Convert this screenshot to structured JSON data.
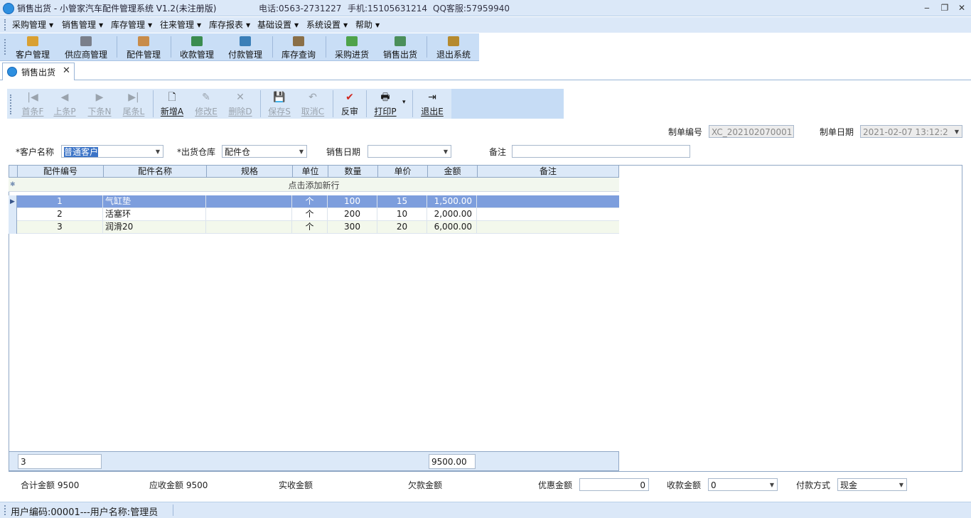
{
  "window": {
    "title": "销售出货 - 小管家汽车配件管理系统 V1.2(未注册版)",
    "phone": "电话:0563-2731227",
    "mobile": "手机:15105631214",
    "qq": "QQ客服:57959940",
    "minimize": "‒",
    "restore": "❐",
    "close": "✕"
  },
  "menu": [
    "采购管理",
    "销售管理",
    "库存管理",
    "往来管理",
    "库存报表",
    "基础设置",
    "系统设置",
    "帮助"
  ],
  "main_toolbar": [
    {
      "label": "客户管理",
      "icon": "customer-icon",
      "color": "#d9a032"
    },
    {
      "label": "供应商管理",
      "icon": "supplier-icon",
      "color": "#7a7f8a"
    },
    {
      "label": "配件管理",
      "icon": "parts-icon",
      "color": "#c88c4a"
    },
    {
      "label": "收款管理",
      "icon": "receipt-icon",
      "color": "#3b8c4f"
    },
    {
      "label": "付款管理",
      "icon": "payment-icon",
      "color": "#3b7fb8"
    },
    {
      "label": "库存查询",
      "icon": "inventory-search-icon",
      "color": "#8a6f47"
    },
    {
      "label": "采购进货",
      "icon": "purchase-icon",
      "color": "#4ea34a"
    },
    {
      "label": "销售出货",
      "icon": "sales-icon",
      "color": "#4b8f5a"
    },
    {
      "label": "退出系统",
      "icon": "exit-system-icon",
      "color": "#b58a2f"
    }
  ],
  "tab": {
    "label": "销售出货",
    "close": "✕"
  },
  "actions": {
    "first": "首条F",
    "prev": "上条P",
    "next": "下条N",
    "last": "尾条L",
    "add": "新增A",
    "edit": "修改E",
    "delete": "删除D",
    "save": "保存S",
    "cancel": "取消C",
    "unaudit": "反审",
    "print": "打印P",
    "exit": "退出E",
    "glyphs": {
      "first": "|◀",
      "prev": "◀",
      "next": "▶",
      "last": "▶|",
      "add": "🗋",
      "edit": "✎",
      "delete": "✕",
      "save": "💾",
      "cancel": "↶",
      "unaudit": "✔",
      "print": "🖶",
      "exit": "⇥",
      "print_dropdown": "▾"
    }
  },
  "form": {
    "doc_no_label": "制单编号",
    "doc_no": "XC_202102070001",
    "doc_date_label": "制单日期",
    "doc_date": "2021-02-07 13:12:2",
    "customer_label": "*客户名称",
    "customer": "普通客户",
    "warehouse_label": "*出货仓库",
    "warehouse": "配件仓",
    "sale_date_label": "销售日期",
    "sale_date": "",
    "remark_label": "备注",
    "remark": ""
  },
  "grid": {
    "columns": [
      "配件编号",
      "配件名称",
      "规格",
      "单位",
      "数量",
      "单价",
      "金额",
      "备注"
    ],
    "new_row_hint": "点击添加新行",
    "rows": [
      {
        "no": "1",
        "name": "气缸垫",
        "spec": "",
        "unit": "个",
        "qty": "100",
        "price": "15",
        "amount": "1,500.00",
        "remark": ""
      },
      {
        "no": "2",
        "name": "活塞环",
        "spec": "",
        "unit": "个",
        "qty": "200",
        "price": "10",
        "amount": "2,000.00",
        "remark": ""
      },
      {
        "no": "3",
        "name": "润滑20",
        "spec": "",
        "unit": "个",
        "qty": "300",
        "price": "20",
        "amount": "6,000.00",
        "remark": ""
      }
    ],
    "footer_count": "3",
    "footer_amount": "9500.00"
  },
  "summary": {
    "total_label": "合计金额",
    "total": "9500",
    "receivable_label": "应收金额",
    "receivable": "9500",
    "received_label": "实收金额",
    "received": "",
    "owed_label": "欠款金额",
    "owed": "",
    "discount_label": "优惠金额",
    "discount": "0",
    "collect_label": "收款金额",
    "collect": "0",
    "paymethod_label": "付款方式",
    "paymethod": "现金"
  },
  "status": {
    "text": "用户编码:00001---用户名称:管理员"
  },
  "colors": {
    "accent": "#dbe8f8",
    "selected_row": "#7d9edd",
    "toolbar": "#c9def6"
  }
}
